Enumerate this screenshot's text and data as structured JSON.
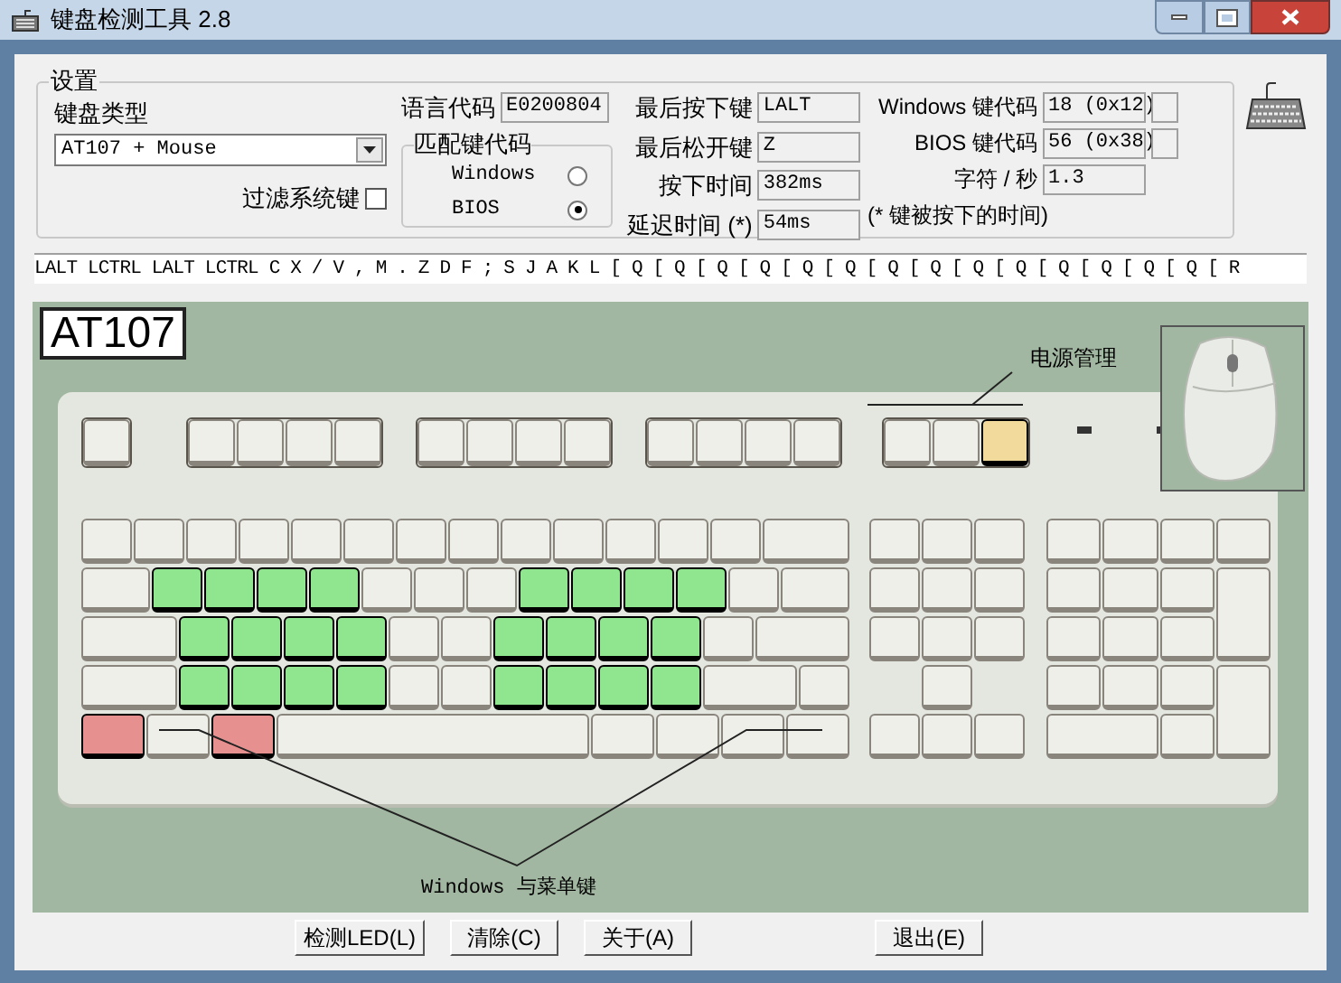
{
  "window": {
    "title": "键盘检测工具 2.8"
  },
  "settings": {
    "title": "设置",
    "keyboard_type_label": "键盘类型",
    "keyboard_type": "AT107 + Mouse",
    "filter_label": "过滤系统键",
    "filter_checked": false,
    "language_code_label": "语言代码",
    "language_code": "E0200804",
    "match_group": {
      "title": "匹配键代码",
      "options": [
        {
          "label": "Windows",
          "selected": false
        },
        {
          "label": "BIOS",
          "selected": true
        }
      ]
    },
    "readouts": [
      {
        "label": "最后按下键",
        "value": "LALT"
      },
      {
        "label": "最后松开键",
        "value": "Z"
      },
      {
        "label": "按下时间",
        "value": "382ms"
      },
      {
        "label": "延迟时间 (*)",
        "value": "54ms"
      }
    ],
    "codes": [
      {
        "kind": "boxed",
        "label": "Windows 键代码",
        "value": "18 (0x12)"
      },
      {
        "kind": "boxed",
        "label": "BIOS 键代码",
        "value": "56 (0x38)"
      },
      {
        "kind": "plain",
        "label": "字符 / 秒",
        "value": "1.3"
      }
    ],
    "note": "(* 键被按下的时间)"
  },
  "log": "LALT LCTRL LALT LCTRL C X / V , M . Z D F ; S J A K L [ Q [ Q [ Q [ Q [ Q [ Q [ Q [ Q [ Q [ Q [ Q [ Q [ Q [ Q [ R",
  "keyboard": {
    "model": "AT107",
    "power_label": "电源管理",
    "windows_label": "Windows 与菜单键",
    "function_groups": [
      [
        {
          "pressed": false
        }
      ],
      [
        {
          "pressed": false
        },
        {
          "pressed": false
        },
        {
          "pressed": false
        },
        {
          "pressed": false
        }
      ],
      [
        {
          "pressed": false
        },
        {
          "pressed": false
        },
        {
          "pressed": false
        },
        {
          "pressed": false
        }
      ],
      [
        {
          "pressed": false
        },
        {
          "pressed": false
        },
        {
          "pressed": false
        },
        {
          "pressed": false
        }
      ],
      [
        {
          "pressed": false
        },
        {
          "pressed": false
        },
        {
          "pressed": true,
          "color": "#f2d99c"
        }
      ]
    ],
    "main_rows": [
      [
        {
          "kind": "key",
          "pressed": false
        },
        {
          "kind": "key",
          "pressed": false
        },
        {
          "kind": "key",
          "pressed": false
        },
        {
          "kind": "key",
          "pressed": false
        },
        {
          "kind": "key",
          "pressed": false
        },
        {
          "kind": "key",
          "pressed": false
        },
        {
          "kind": "key",
          "pressed": false
        },
        {
          "kind": "key",
          "pressed": false
        },
        {
          "kind": "key",
          "pressed": false
        },
        {
          "kind": "key",
          "pressed": false
        },
        {
          "kind": "key",
          "pressed": false
        },
        {
          "kind": "key",
          "pressed": false
        },
        {
          "kind": "key",
          "pressed": false
        },
        {
          "kind": "wide",
          "pressed": false
        }
      ],
      [
        {
          "kind": "wide",
          "pressed": false
        },
        {
          "kind": "key",
          "pressed": true,
          "color": "#8fe68f"
        },
        {
          "kind": "key",
          "pressed": true,
          "color": "#8fe68f"
        },
        {
          "kind": "key",
          "pressed": true,
          "color": "#8fe68f"
        },
        {
          "kind": "key",
          "pressed": true,
          "color": "#8fe68f"
        },
        {
          "kind": "key",
          "pressed": false
        },
        {
          "kind": "key",
          "pressed": false
        },
        {
          "kind": "key",
          "pressed": false
        },
        {
          "kind": "key",
          "pressed": true,
          "color": "#8fe68f"
        },
        {
          "kind": "key",
          "pressed": true,
          "color": "#8fe68f"
        },
        {
          "kind": "key",
          "pressed": true,
          "color": "#8fe68f"
        },
        {
          "kind": "key",
          "pressed": true,
          "color": "#8fe68f"
        },
        {
          "kind": "key",
          "pressed": false
        },
        {
          "kind": "wide",
          "pressed": false
        }
      ],
      [
        {
          "kind": "wide",
          "pressed": false
        },
        {
          "kind": "key",
          "pressed": true,
          "color": "#8fe68f"
        },
        {
          "kind": "key",
          "pressed": true,
          "color": "#8fe68f"
        },
        {
          "kind": "key",
          "pressed": true,
          "color": "#8fe68f"
        },
        {
          "kind": "key",
          "pressed": true,
          "color": "#8fe68f"
        },
        {
          "kind": "key",
          "pressed": false
        },
        {
          "kind": "key",
          "pressed": false
        },
        {
          "kind": "key",
          "pressed": true,
          "color": "#8fe68f"
        },
        {
          "kind": "key",
          "pressed": true,
          "color": "#8fe68f"
        },
        {
          "kind": "key",
          "pressed": true,
          "color": "#8fe68f"
        },
        {
          "kind": "key",
          "pressed": true,
          "color": "#8fe68f"
        },
        {
          "kind": "key",
          "pressed": false
        },
        {
          "kind": "wide",
          "pressed": false
        }
      ],
      [
        {
          "kind": "wide",
          "pressed": false
        },
        {
          "kind": "key",
          "pressed": true,
          "color": "#8fe68f"
        },
        {
          "kind": "key",
          "pressed": true,
          "color": "#8fe68f"
        },
        {
          "kind": "key",
          "pressed": true,
          "color": "#8fe68f"
        },
        {
          "kind": "key",
          "pressed": true,
          "color": "#8fe68f"
        },
        {
          "kind": "key",
          "pressed": false
        },
        {
          "kind": "key",
          "pressed": false
        },
        {
          "kind": "key",
          "pressed": true,
          "color": "#8fe68f"
        },
        {
          "kind": "key",
          "pressed": true,
          "color": "#8fe68f"
        },
        {
          "kind": "key",
          "pressed": true,
          "color": "#8fe68f"
        },
        {
          "kind": "key",
          "pressed": true,
          "color": "#8fe68f"
        },
        {
          "kind": "wide",
          "pressed": false
        },
        {
          "kind": "key",
          "pressed": false
        }
      ],
      [
        {
          "kind": "mod",
          "pressed": true,
          "color": "#e79090"
        },
        {
          "kind": "mod",
          "pressed": false
        },
        {
          "kind": "mod",
          "pressed": true,
          "color": "#e79090"
        },
        {
          "kind": "space",
          "pressed": false
        },
        {
          "kind": "mod",
          "pressed": false
        },
        {
          "kind": "mod",
          "pressed": false
        },
        {
          "kind": "mod",
          "pressed": false
        },
        {
          "kind": "mod",
          "pressed": false
        }
      ]
    ],
    "nav_rows": [
      [
        {
          "kind": "key",
          "pressed": false
        },
        {
          "kind": "key",
          "pressed": false
        },
        {
          "kind": "key",
          "pressed": false
        }
      ],
      [
        {
          "kind": "key",
          "pressed": false
        },
        {
          "kind": "key",
          "pressed": false
        },
        {
          "kind": "key",
          "pressed": false
        }
      ],
      [
        {
          "kind": "key",
          "pressed": false
        },
        {
          "kind": "key",
          "pressed": false
        },
        {
          "kind": "key",
          "pressed": false
        }
      ],
      [
        {
          "kind": "gap"
        },
        {
          "kind": "key",
          "pressed": false
        },
        {
          "kind": "gap"
        }
      ],
      [
        {
          "kind": "key",
          "pressed": false
        },
        {
          "kind": "key",
          "pressed": false
        },
        {
          "kind": "key",
          "pressed": false
        }
      ]
    ],
    "numpad": [
      {
        "kind": "key",
        "pressed": false
      },
      {
        "kind": "key",
        "pressed": false
      },
      {
        "kind": "key",
        "pressed": false
      },
      {
        "kind": "key",
        "pressed": false
      },
      {
        "kind": "key",
        "pressed": false
      },
      {
        "kind": "key",
        "pressed": false
      },
      {
        "kind": "key",
        "pressed": false
      },
      {
        "kind": "tall",
        "pressed": false
      },
      {
        "kind": "key",
        "pressed": false
      },
      {
        "kind": "key",
        "pressed": false
      },
      {
        "kind": "key",
        "pressed": false
      },
      {
        "kind": "key",
        "pressed": false
      },
      {
        "kind": "key",
        "pressed": false
      },
      {
        "kind": "key",
        "pressed": false
      },
      {
        "kind": "tall",
        "pressed": false
      },
      {
        "kind": "wide",
        "pressed": false
      },
      {
        "kind": "key",
        "pressed": false
      }
    ]
  },
  "buttons": [
    "检测LED(L)",
    "清除(C)",
    "关于(A)",
    "退出(E)"
  ]
}
